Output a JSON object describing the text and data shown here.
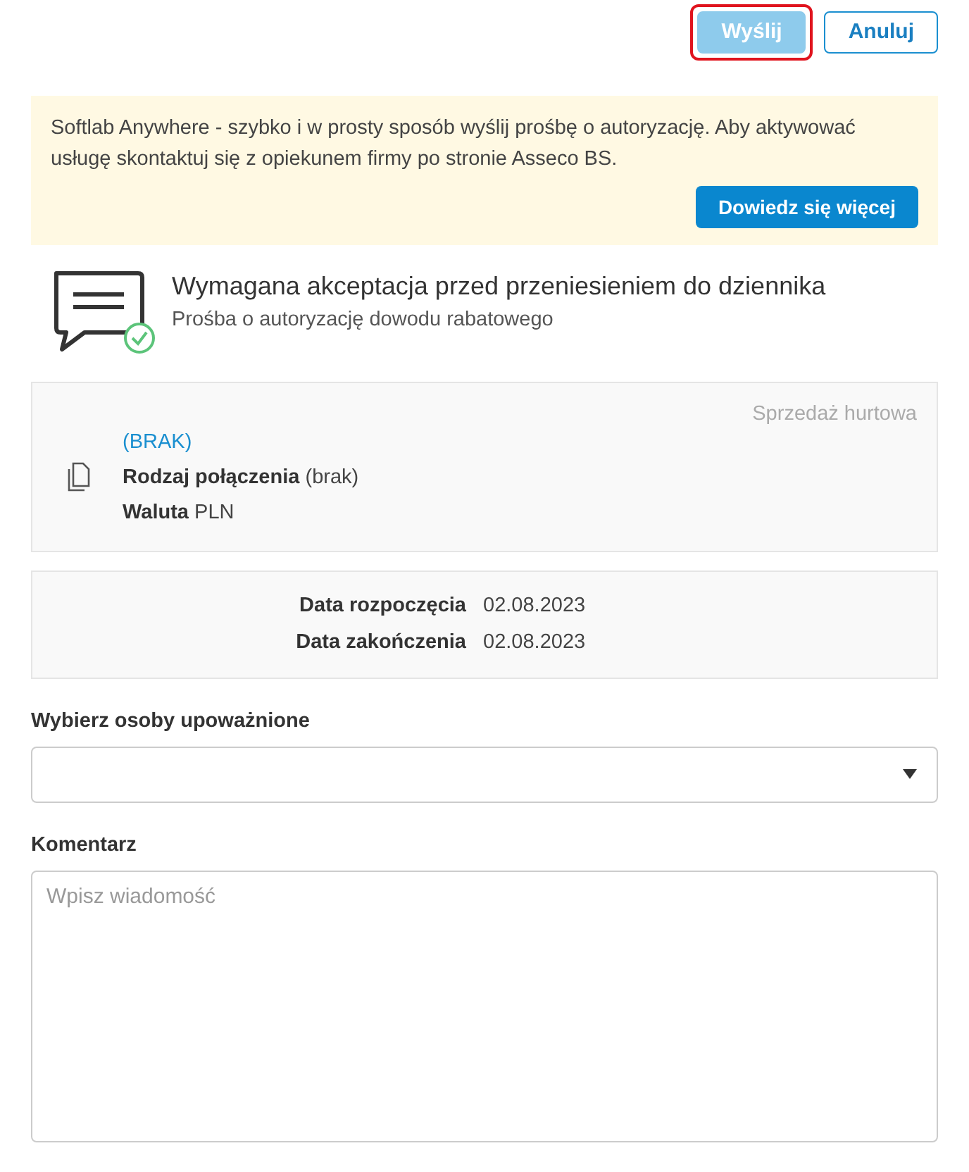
{
  "actions": [
    {
      "label": "Wyślij",
      "kind": "primary",
      "disabled": true,
      "highlighted": true
    },
    {
      "label": "Anuluj",
      "kind": "secondary",
      "disabled": false,
      "highlighted": false
    }
  ],
  "banner": {
    "text": "Softlab Anywhere - szybko i w prosty sposób wyślij prośbę o autoryzację. Aby aktywować usługę skontaktuj się z opiekunem firmy po stronie Asseco BS.",
    "button": "Dowiedz się więcej"
  },
  "header": {
    "title": "Wymagana akceptacja przed przeniesieniem do dziennika",
    "subtitle": "Prośba o autoryzację dowodu rabatowego"
  },
  "document": {
    "category": "Sprzedaż hurtowa",
    "link": "(BRAK)",
    "fields": [
      {
        "label": "Rodzaj połączenia",
        "value": "(brak)"
      },
      {
        "label": "Waluta",
        "value": "PLN"
      }
    ]
  },
  "dates": [
    {
      "label": "Data rozpoczęcia",
      "value": "02.08.2023"
    },
    {
      "label": "Data zakończenia",
      "value": "02.08.2023"
    }
  ],
  "authorized_select": {
    "label": "Wybierz osoby upoważnione"
  },
  "comment": {
    "label": "Komentarz",
    "placeholder": "Wpisz wiadomość"
  }
}
